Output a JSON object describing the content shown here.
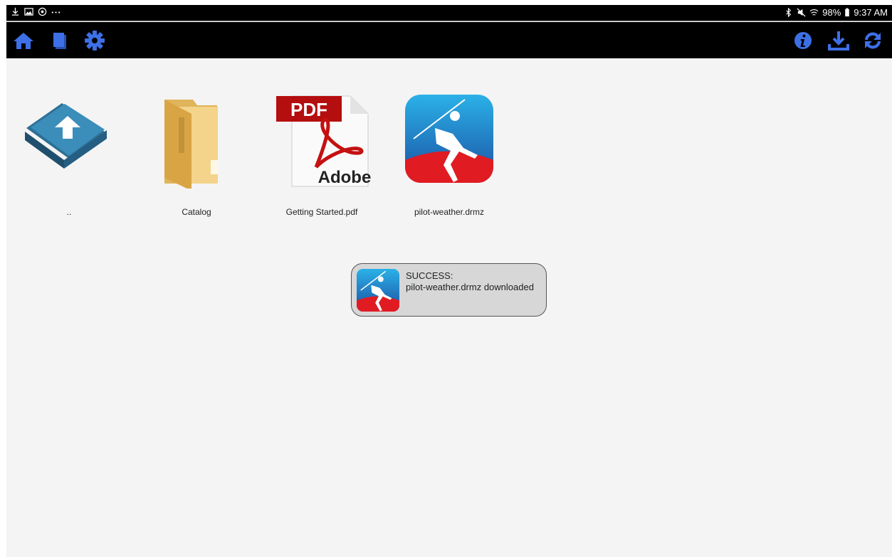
{
  "status_bar": {
    "left_icons": [
      "download-icon",
      "image-icon",
      "sync-icon",
      "more-icon"
    ],
    "battery": "98%",
    "time": "9:37 AM"
  },
  "toolbar": {
    "accent_color": "#3d6fe6",
    "left_buttons": [
      "home-icon",
      "pages-icon",
      "gear-icon"
    ],
    "right_buttons": [
      "info-icon",
      "download-icon",
      "refresh-icon"
    ]
  },
  "files": [
    {
      "name": "..",
      "type": "parent-folder"
    },
    {
      "name": "Catalog",
      "type": "folder"
    },
    {
      "name": "Getting Started.pdf",
      "type": "pdf",
      "badge": "PDF",
      "brand": "Adobe"
    },
    {
      "name": "pilot-weather.drmz",
      "type": "drmz"
    }
  ],
  "toast": {
    "title": "SUCCESS:",
    "message": "pilot-weather.drmz downloaded"
  }
}
